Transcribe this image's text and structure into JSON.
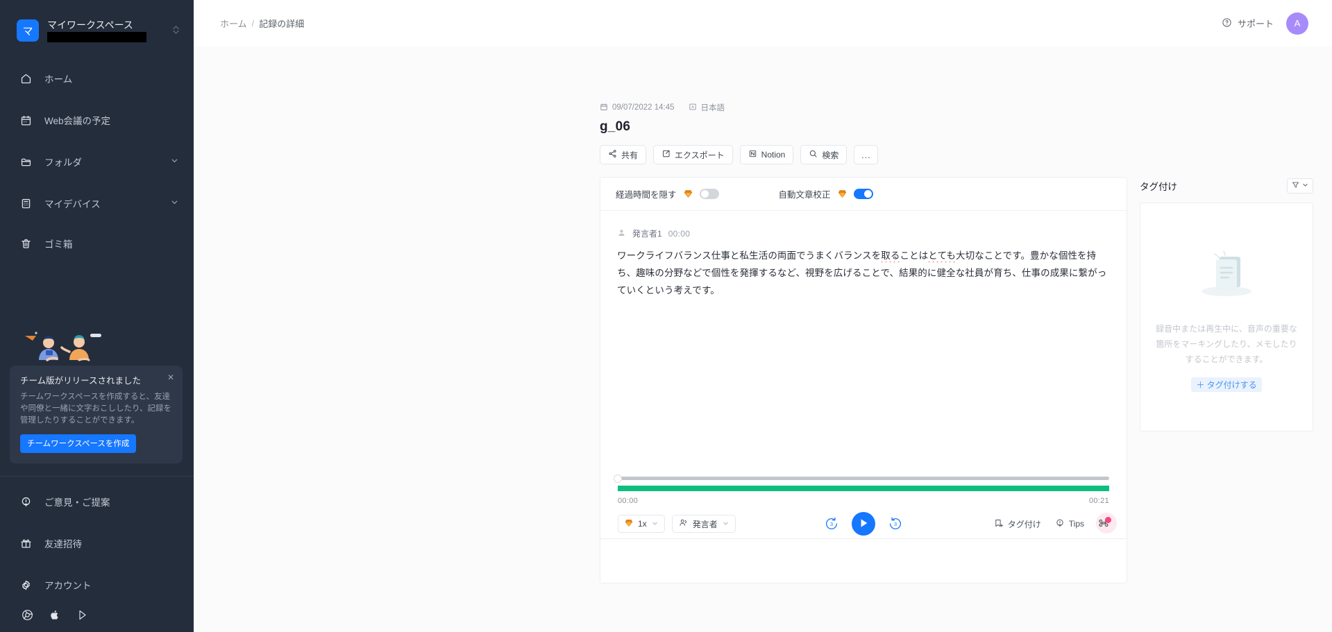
{
  "sidebar": {
    "workspace": {
      "name": "マイワークスペース",
      "logo_letter": "マ",
      "redacted": true,
      "switch_icon": "chevron-up-down-icon"
    },
    "items": [
      {
        "label": "ホーム",
        "icon": "home-icon",
        "expandable": false
      },
      {
        "label": "Web会議の予定",
        "icon": "calendar-icon",
        "expandable": false
      },
      {
        "label": "フォルダ",
        "icon": "folder-icon",
        "expandable": true
      },
      {
        "label": "マイデバイス",
        "icon": "device-icon",
        "expandable": true
      },
      {
        "label": "ゴミ箱",
        "icon": "trash-icon",
        "expandable": false
      }
    ],
    "promo": {
      "title": "チーム版がリリースされました",
      "body": "チームワークスペースを作成すると、友達や同僚と一緒に文字おこししたり、記録を管理したりすることができます。",
      "button": "チームワークスペースを作成",
      "close_icon": "close-icon",
      "button_color": "#1677ff"
    },
    "footer_items": [
      {
        "label": "ご意見・ご提案",
        "icon": "lightbulb-pin-icon"
      },
      {
        "label": "友達招待",
        "icon": "gift-icon"
      },
      {
        "label": "アカウント",
        "icon": "gear-icon"
      }
    ],
    "store_icons": [
      "chrome-icon",
      "apple-icon",
      "google-play-icon"
    ],
    "background_color": "#242d3c"
  },
  "topbar": {
    "breadcrumb": {
      "home": "ホーム",
      "separator": "/",
      "current": "記録の詳細"
    },
    "support_label": "サポート",
    "support_icon": "question-circle-icon",
    "avatar_letter": "A",
    "avatar_color": "#a78bfa"
  },
  "document": {
    "date": "09/07/2022 14:45",
    "date_icon": "calendar-icon",
    "language": "日本語",
    "language_icon": "language-icon",
    "title": "g_06",
    "actions": [
      {
        "label": "共有",
        "icon": "share-icon"
      },
      {
        "label": "エクスポート",
        "icon": "export-icon"
      },
      {
        "label": "Notion",
        "icon": "notion-icon"
      },
      {
        "label": "検索",
        "icon": "search-icon"
      },
      {
        "label": "…",
        "icon": "more-icon"
      }
    ]
  },
  "transcript": {
    "toolbar": {
      "hide_elapsed_label": "経過時間を隠す",
      "hide_elapsed_on": false,
      "auto_proofread_label": "自動文章校正",
      "auto_proofread_on": true,
      "premium_icon": "diamond-icon",
      "toggle_on_color": "#1677ff"
    },
    "speaker": {
      "name": "発言者1",
      "time": "00:00",
      "icon": "person-icon"
    },
    "text_part1": "ワークライフバランス仕事と私生活の両面でうまくバランスを",
    "text_spell1": "取る",
    "text_part2": "ことは",
    "text_spell2": "とても",
    "text_part3": "大切なことです。豊かな個性を持ち、趣味の分野などで個性を発揮するなど、視野を広げることで、結果的に健全な社員が育ち、仕事の成果に繋がっていくという考えです。"
  },
  "tags": {
    "title": "タグ付け",
    "filter_icon": "filter-icon",
    "filter_chevron": "chevron-down-icon",
    "empty_icon": "empty-document-icon",
    "empty_text": "録音中または再生中に、音声の重要な箇所をマーキングしたり、メモしたりすることができます。",
    "add_label": "＋ タグ付けする",
    "add_color": "#4a93f0"
  },
  "player": {
    "current_time": "00:00",
    "total_time": "00:21",
    "progress_percent": 0,
    "waveform_color": "#0dbf7f",
    "track_color": "#c3c6cb",
    "speed_label": "1x",
    "speed_icon": "diamond-icon",
    "speed_chevron": "chevron-down-icon",
    "speaker_label": "発言者",
    "speaker_icon": "people-icon",
    "speaker_chevron": "chevron-down-icon",
    "rewind_label": "3",
    "forward_label": "3",
    "play_icon": "play-icon",
    "play_color": "#1677ff",
    "right_actions": [
      {
        "label": "タグ付け",
        "icon": "tag-add-icon"
      },
      {
        "label": "Tips",
        "icon": "lightbulb-pin-icon"
      }
    ],
    "keyboard_icon": "keyboard-shortcut-icon",
    "keyboard_badge_color": "#f5477c"
  }
}
